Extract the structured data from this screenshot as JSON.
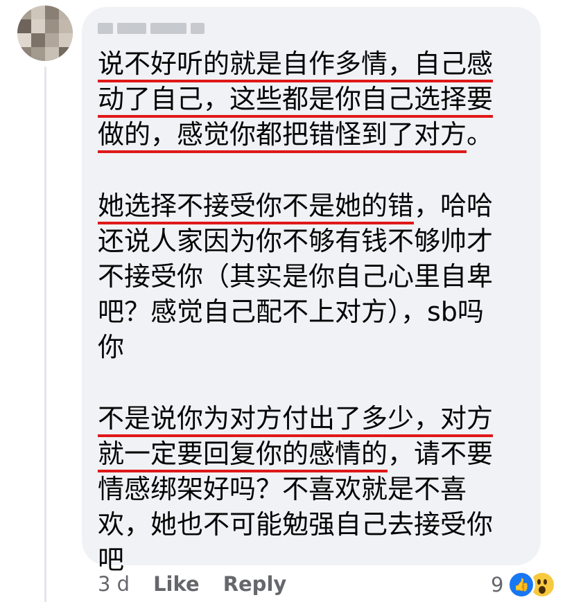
{
  "comment": {
    "paragraphs": [
      {
        "lines": [
          [
            {
              "t": "说不好听的就是自作多情，自己感",
              "u": true
            }
          ],
          [
            {
              "t": "动了自己，这些都是你自己选择要",
              "u": true
            }
          ],
          [
            {
              "t": "做的，感觉你都把错怪到了对方",
              "u": true
            },
            {
              "t": "。",
              "u": false
            }
          ]
        ]
      },
      {
        "lines": [
          [
            {
              "t": "她选择不接受你不是她的错",
              "u": true
            },
            {
              "t": "，哈哈",
              "u": false
            }
          ],
          [
            {
              "t": "还说人家因为你不够有钱不够帅才",
              "u": false
            }
          ],
          [
            {
              "t": "不接受你（其实是你自己心里自卑",
              "u": false
            }
          ],
          [
            {
              "t": "吧？感觉自己配不上对方），sb吗",
              "u": false
            }
          ],
          [
            {
              "t": "你",
              "u": false
            }
          ]
        ]
      },
      {
        "lines": [
          [
            {
              "t": "不是说你为对方付出了多少，对方",
              "u": true
            }
          ],
          [
            {
              "t": "就一定要回复你的感情的",
              "u": true
            },
            {
              "t": "，请不要",
              "u": false
            }
          ],
          [
            {
              "t": "情感绑架好吗？不喜欢就是不喜",
              "u": false
            }
          ],
          [
            {
              "t": "欢，她也不可能勉强自己去接受你",
              "u": false
            }
          ],
          [
            {
              "t": "吧",
              "u": false
            }
          ]
        ]
      }
    ]
  },
  "actions": {
    "time": "3 d",
    "like_label": "Like",
    "reply_label": "Reply"
  },
  "reactions": {
    "count": "9",
    "icons": [
      "like-icon",
      "wow-icon"
    ],
    "like_color": "#1877f2",
    "wow_color": "#f7c93e"
  },
  "colors": {
    "underline": "#e01818",
    "bubble": "#f0f2f5",
    "meta_text": "#65676b"
  }
}
